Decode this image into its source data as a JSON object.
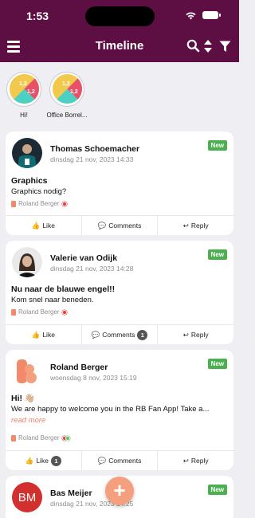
{
  "status_bar": {
    "time": "1:53"
  },
  "navbar": {
    "title": "Timeline",
    "menu_icon": "hamburger-menu-icon",
    "search_icon": "search-icon",
    "sort_icon": "sort-icon",
    "filter_icon": "filter-icon"
  },
  "stories": [
    {
      "label": "Hi!",
      "icon": "group-avatar-icon"
    },
    {
      "label": "Office Borrel...",
      "icon": "group-avatar-icon"
    }
  ],
  "posts": [
    {
      "author": "Thomas Schoemacher",
      "date": "dinsdag 21 nov, 2023 14:33",
      "badge": "New",
      "title": "Graphics",
      "body": "Graphics nodig?",
      "source": "Roland Berger",
      "actions": {
        "like": "Like",
        "comments": "Comments",
        "reply": "Reply"
      }
    },
    {
      "author": "Valerie van Odijk",
      "date": "dinsdag 21 nov, 2023 14:28",
      "badge": "New",
      "title": "Nu naar de blauwe engel!!",
      "body": "Kom snel naar beneden.",
      "source": "Roland Berger",
      "actions": {
        "like": "Like",
        "comments": "Comments",
        "comments_count": "1",
        "reply": "Reply"
      }
    },
    {
      "author": "Roland Berger",
      "date": "woensdag 8 nov, 2023 15:19",
      "badge": "New",
      "title": "Hi! 👋🏼",
      "body": "We are happy to welcome you in the RB Fan App! Take a...",
      "read_more": "read more",
      "source": "Roland Berger",
      "actions": {
        "like": "Like",
        "like_count": "1",
        "comments": "Comments",
        "reply": "Reply"
      }
    },
    {
      "author": "Bas Meijer",
      "avatar_initials": "BM",
      "date": "dinsdag 21 nov, 2023 14:25",
      "badge": "New"
    }
  ],
  "fab": {
    "label": "+"
  },
  "colors": {
    "brand": "#5d0f44",
    "accent": "#f4a07e",
    "badge_new": "#4caf50",
    "background": "#efeef3"
  }
}
